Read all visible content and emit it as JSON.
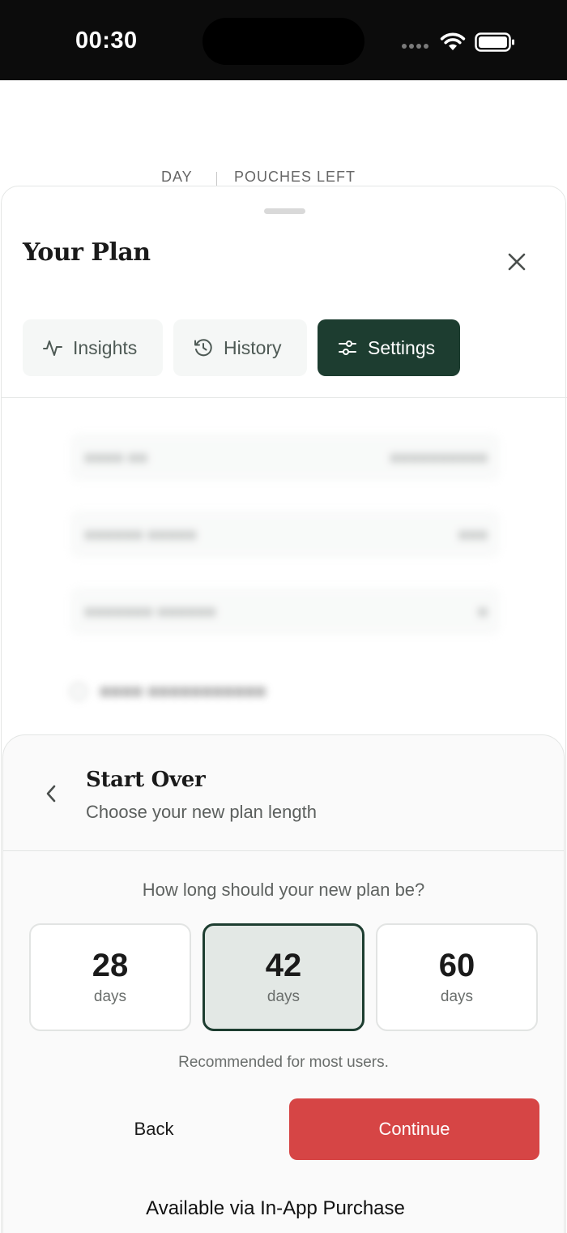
{
  "status_bar": {
    "time": "00:30"
  },
  "background": {
    "day_label": "DAY",
    "pouches_label": "POUCHES LEFT"
  },
  "sheet": {
    "title": "Your Plan",
    "tabs": [
      {
        "label": "Insights",
        "icon": "pulse-icon",
        "active": false
      },
      {
        "label": "History",
        "icon": "history-icon",
        "active": false
      },
      {
        "label": "Settings",
        "icon": "sliders-icon",
        "active": true
      }
    ]
  },
  "modal": {
    "title": "Start Over",
    "subtitle": "Choose your new plan length",
    "question": "How long should your new plan be?",
    "options": [
      {
        "value": "28",
        "unit": "days",
        "selected": false
      },
      {
        "value": "42",
        "unit": "days",
        "selected": true
      },
      {
        "value": "60",
        "unit": "days",
        "selected": false
      }
    ],
    "recommendation": "Recommended for most users.",
    "back_label": "Back",
    "continue_label": "Continue",
    "iap_note": "Available via In-App Purchase"
  },
  "colors": {
    "accent_dark_green": "#1d3d30",
    "continue_red": "#d64545",
    "selected_option_bg": "#e3e8e5"
  }
}
